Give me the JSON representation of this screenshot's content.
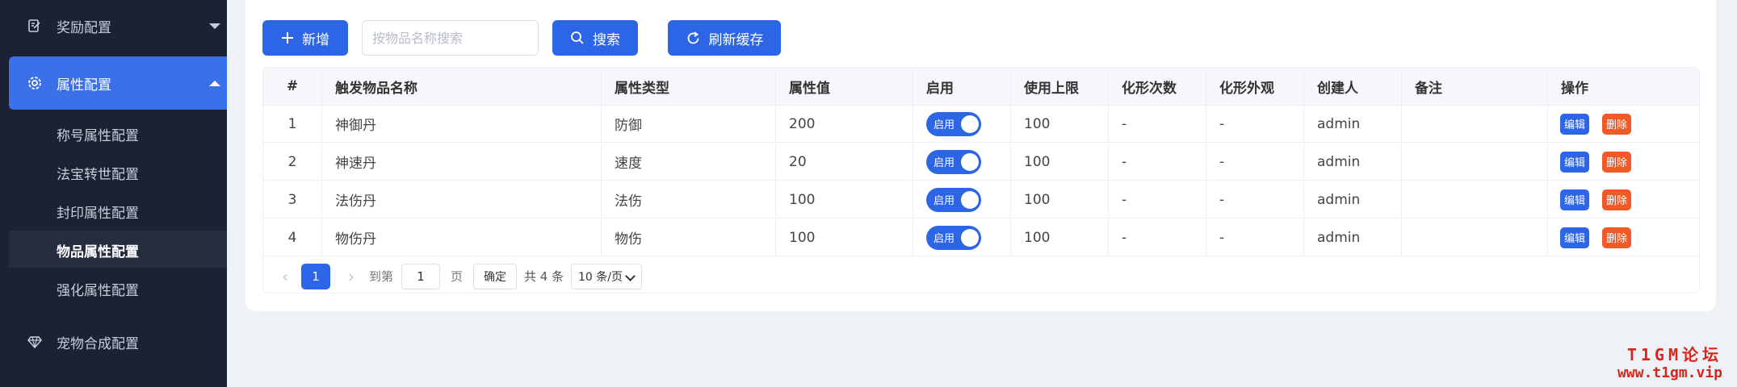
{
  "sidebar": {
    "reward_label": "奖励配置",
    "attr_label": "属性配置",
    "sub_items": [
      "称号属性配置",
      "法宝转世配置",
      "封印属性配置",
      "物品属性配置",
      "强化属性配置"
    ],
    "pet_label": "宠物合成配置"
  },
  "toolbar": {
    "add_label": "新增",
    "search_placeholder": "按物品名称搜索",
    "search_label": "搜索",
    "refresh_label": "刷新缓存"
  },
  "table": {
    "columns": [
      "#",
      "触发物品名称",
      "属性类型",
      "属性值",
      "启用",
      "使用上限",
      "化形次数",
      "化形外观",
      "创建人",
      "备注",
      "操作"
    ],
    "rows": [
      {
        "idx": "1",
        "name": "神御丹",
        "type": "防御",
        "value": "200",
        "enabled": "启用",
        "limit": "100",
        "morph_count": "-",
        "morph_look": "-",
        "creator": "admin",
        "remark": ""
      },
      {
        "idx": "2",
        "name": "神速丹",
        "type": "速度",
        "value": "20",
        "enabled": "启用",
        "limit": "100",
        "morph_count": "-",
        "morph_look": "-",
        "creator": "admin",
        "remark": ""
      },
      {
        "idx": "3",
        "name": "法伤丹",
        "type": "法伤",
        "value": "100",
        "enabled": "启用",
        "limit": "100",
        "morph_count": "-",
        "morph_look": "-",
        "creator": "admin",
        "remark": ""
      },
      {
        "idx": "4",
        "name": "物伤丹",
        "type": "物伤",
        "value": "100",
        "enabled": "启用",
        "limit": "100",
        "morph_count": "-",
        "morph_look": "-",
        "creator": "admin",
        "remark": ""
      }
    ],
    "edit_label": "编辑",
    "delete_label": "删除"
  },
  "pagination": {
    "current_page": "1",
    "goto_label": "到第",
    "goto_value": "1",
    "page_unit": "页",
    "confirm_label": "确定",
    "total_label": "共 4 条",
    "page_size": "10 条/页"
  },
  "watermark": {
    "line1": "T1GM论坛",
    "line2": "www.t1gm.vip"
  },
  "colors": {
    "primary": "#2c66e6",
    "danger": "#f15a24",
    "sidebar_bg": "#1a2234",
    "watermark": "#d9261c"
  }
}
